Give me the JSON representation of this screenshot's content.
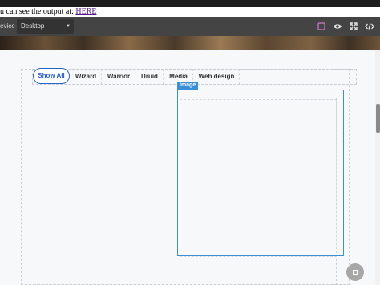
{
  "note": {
    "prefix": "u can see the output at: ",
    "link_text": "HERE"
  },
  "toolbar": {
    "device_label": "evice",
    "device_select_value": "Desktop",
    "icons": [
      "square-icon",
      "eye-icon",
      "fullscreen-icon",
      "code-icon"
    ]
  },
  "filters": {
    "tabs": [
      {
        "label": "Show All",
        "active": true
      },
      {
        "label": "Wizard",
        "active": false
      },
      {
        "label": "Warrior",
        "active": false
      },
      {
        "label": "Druid",
        "active": false
      },
      {
        "label": "Media",
        "active": false
      },
      {
        "label": "Web design",
        "active": false
      }
    ]
  },
  "selection": {
    "tag": "Image"
  },
  "colors": {
    "accent": "#2b63c6",
    "selection": "#3a8fd6",
    "toolbar": "#444444",
    "square_icon": "#d278d0"
  }
}
